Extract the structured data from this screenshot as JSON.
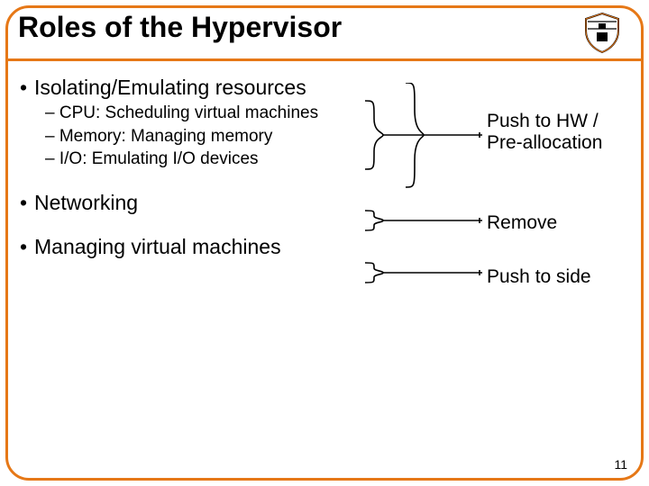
{
  "title": "Roles of the Hypervisor",
  "bullets": {
    "b1": {
      "label": "Isolating/Emulating resources",
      "subs": [
        "CPU: Scheduling virtual machines",
        "Memory: Managing memory",
        "I/O: Emulating I/O devices"
      ]
    },
    "b2": {
      "label": "Networking"
    },
    "b3": {
      "label": "Managing virtual machines"
    }
  },
  "annotations": {
    "a1": "Push to HW / Pre-allocation",
    "a2": "Remove",
    "a3": "Push to side"
  },
  "page_number": "11",
  "colors": {
    "accent": "#e67817"
  }
}
